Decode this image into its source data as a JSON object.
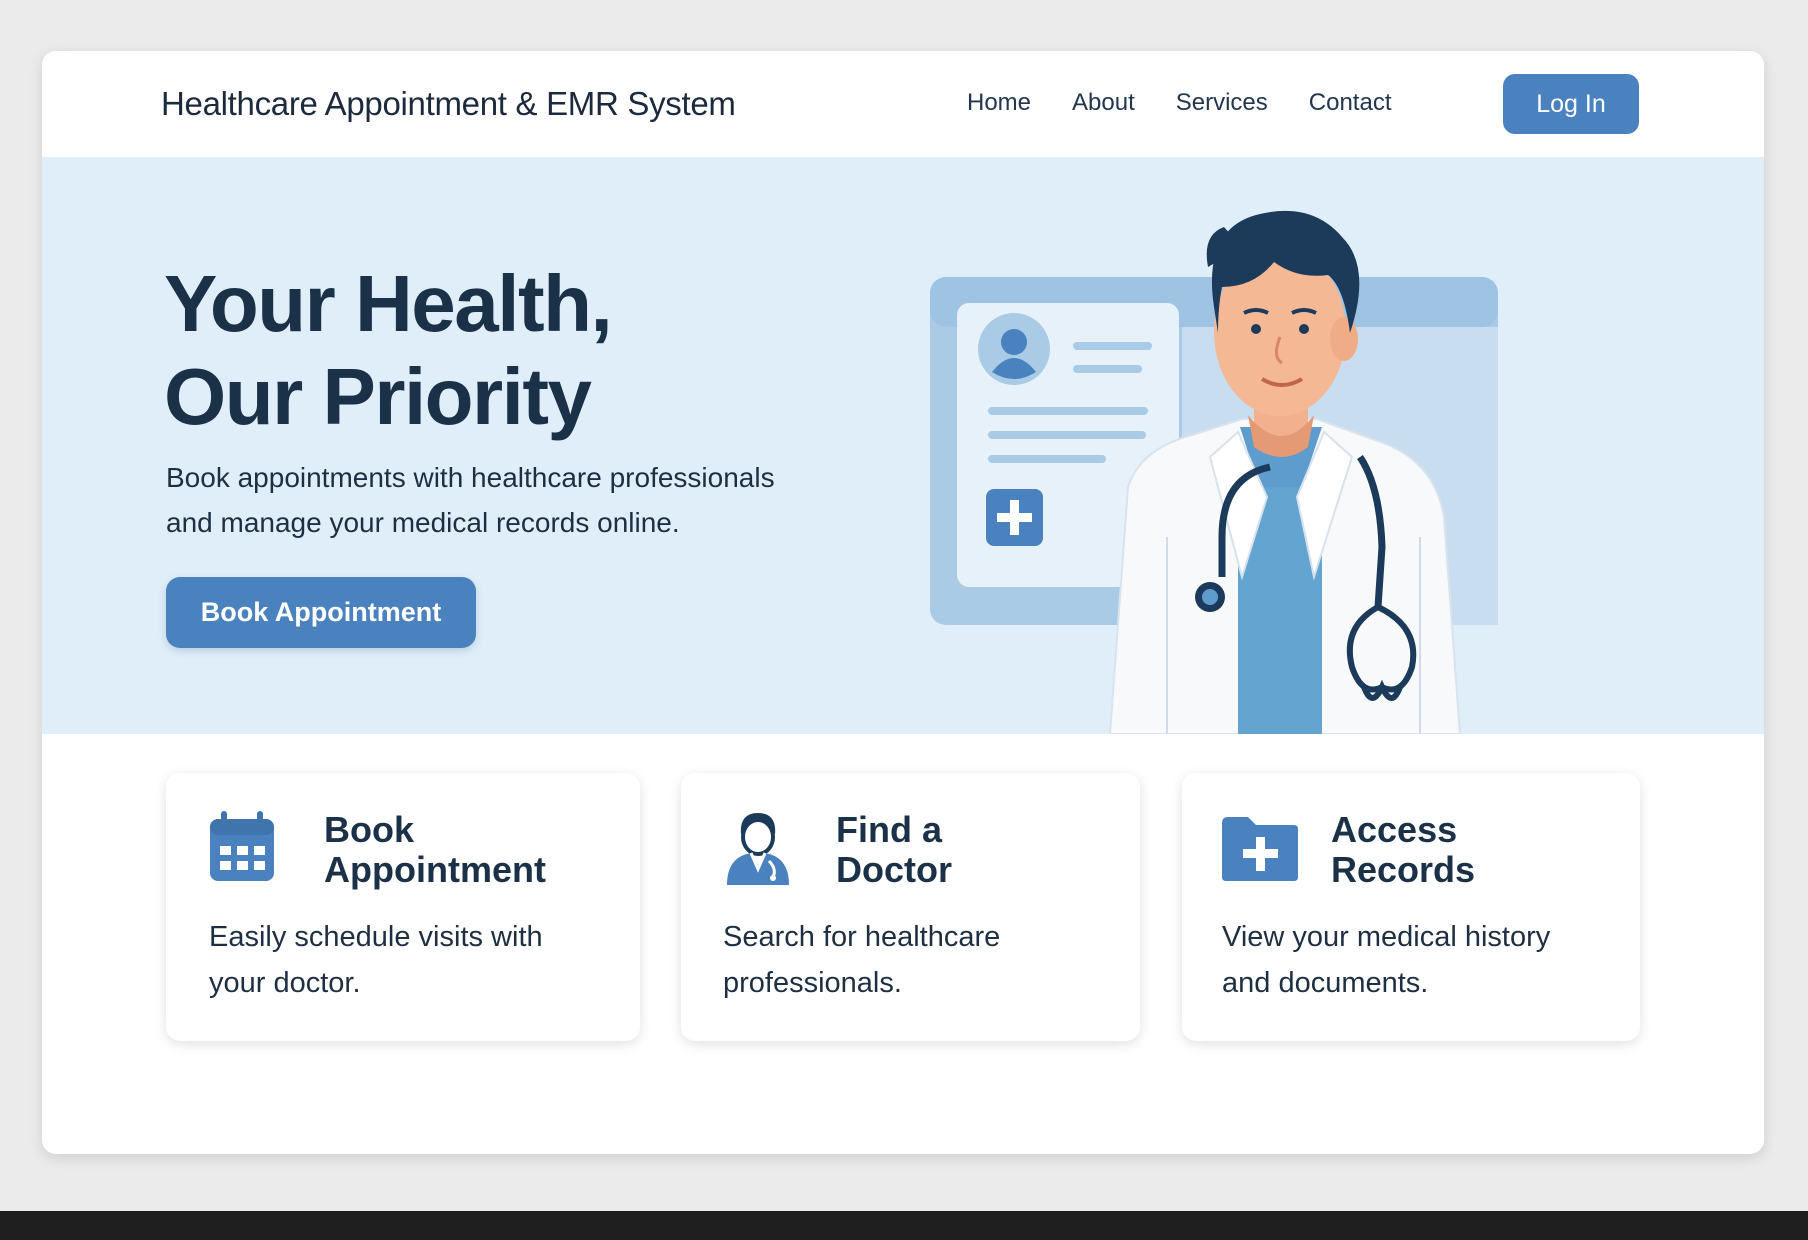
{
  "header": {
    "brand": "Healthcare Appointment & EMR System",
    "nav": [
      "Home",
      "About",
      "Services",
      "Contact"
    ],
    "login_label": "Log In"
  },
  "hero": {
    "title_line1": "Your Health,",
    "title_line2": "Our Priority",
    "subtitle_line1": "Book appointments with healthcare professionals",
    "subtitle_line2": "and manage your medical records online.",
    "cta_label": "Book Appointment",
    "illustration": "doctor-with-medical-record-card"
  },
  "cards": [
    {
      "icon": "calendar-icon",
      "title_line1": "Book",
      "title_line2": "Appointment",
      "desc_line1": "Easily schedule visits with",
      "desc_line2": "your doctor."
    },
    {
      "icon": "doctor-icon",
      "title_line1": "Find a",
      "title_line2": "Doctor",
      "desc_line1": "Search for healthcare",
      "desc_line2": "professionals."
    },
    {
      "icon": "medical-folder-icon",
      "title_line1": "Access",
      "title_line2": "Records",
      "desc_line1": "View your medical history",
      "desc_line2": "and documents."
    }
  ],
  "colors": {
    "accent": "#4a82bf",
    "hero_bg": "#e0eef9",
    "heading": "#1b3148",
    "page_bg": "#ebebeb"
  }
}
